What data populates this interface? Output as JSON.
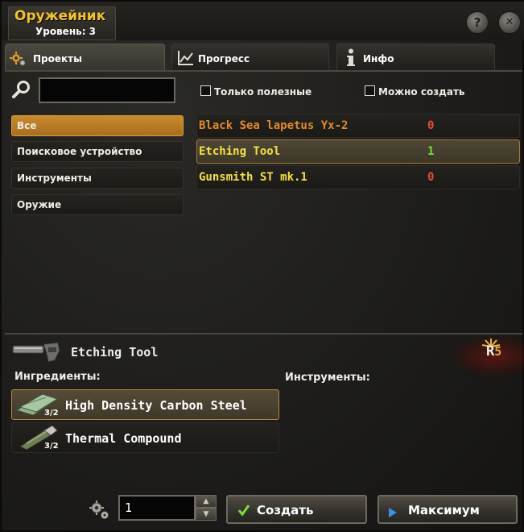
{
  "window": {
    "title": "Оружейник",
    "level": "Уровень: 3",
    "help_glyph": "?",
    "close_glyph": "✕"
  },
  "tabs": [
    {
      "label": "Проекты",
      "icon": "gear-icon",
      "active": true
    },
    {
      "label": "Прогресс",
      "icon": "chart-icon",
      "active": false
    },
    {
      "label": "Инфо",
      "icon": "info-icon",
      "active": false
    }
  ],
  "search": {
    "value": "",
    "placeholder": ""
  },
  "filters": {
    "useful_only": "Только полезные",
    "can_craft": "Можно создать"
  },
  "categories": [
    {
      "label": "Все",
      "active": true
    },
    {
      "label": "Поисковое устройство",
      "active": false
    },
    {
      "label": "Инструменты",
      "active": false
    },
    {
      "label": "Оружие",
      "active": false
    }
  ],
  "recipes": [
    {
      "name": "Black Sea lapetus Yx-2",
      "count": "0",
      "name_color": "#e38a2a",
      "count_color": "#e14b3c"
    },
    {
      "name": "Etching Tool",
      "count": "1",
      "name_color": "#f5e044",
      "count_color": "#7ddc3c"
    },
    {
      "name": "Gunsmith ST mk.1",
      "count": "0",
      "name_color": "#f5e044",
      "count_color": "#e14b3c"
    }
  ],
  "detail": {
    "title": "Etching Tool",
    "ingredients_label": "Ингредиенты:",
    "tools_label": "Инструменты:",
    "rank_letter": "R",
    "rank_value": "5",
    "ingredients": [
      {
        "name": "High Density Carbon Steel",
        "qty": "3/2",
        "icon": "steel-plates-icon"
      },
      {
        "name": "Thermal Compound",
        "qty": "3/2",
        "icon": "thermal-tube-icon"
      }
    ]
  },
  "footer": {
    "quantity": "1",
    "spin_up": "▲",
    "spin_down": "▼",
    "create_label": "Создать",
    "max_label": "Максимум"
  },
  "colors": {
    "accent_gold": "#f2c230",
    "selected_category": "#c98a2e",
    "selected_border": "#a37a32"
  }
}
